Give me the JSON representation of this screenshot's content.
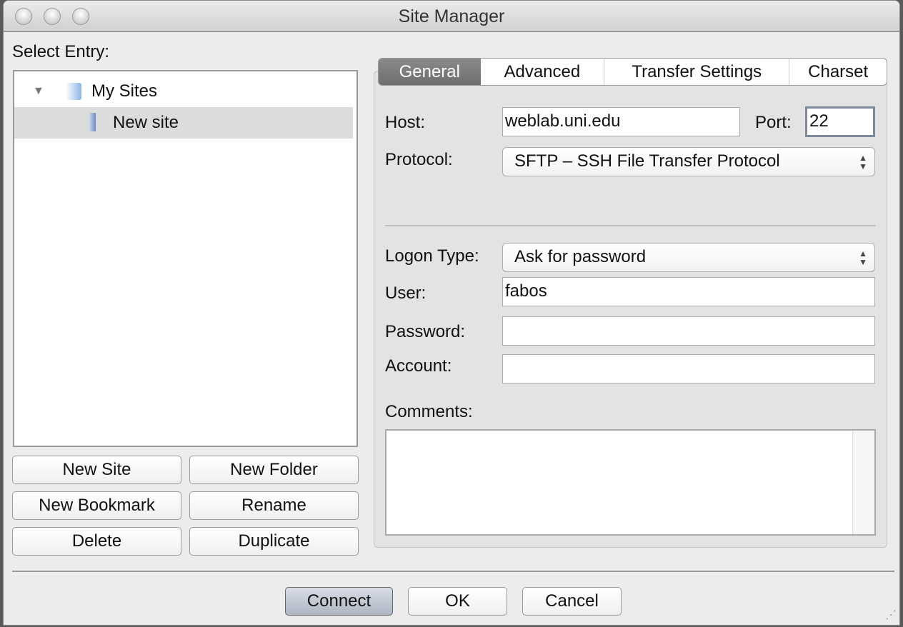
{
  "window": {
    "title": "Site Manager"
  },
  "left": {
    "select_entry_label": "Select Entry:",
    "tree": [
      {
        "label": "My Sites",
        "icon": "folder-icon",
        "expanded": true
      },
      {
        "label": "New site",
        "icon": "server-icon",
        "selected": true
      }
    ],
    "buttons": {
      "new_site": "New Site",
      "new_folder": "New Folder",
      "new_bookmark": "New Bookmark",
      "rename": "Rename",
      "delete": "Delete",
      "duplicate": "Duplicate"
    }
  },
  "tabs": [
    {
      "label": "General",
      "active": true
    },
    {
      "label": "Advanced"
    },
    {
      "label": "Transfer Settings"
    },
    {
      "label": "Charset"
    }
  ],
  "general": {
    "host_label": "Host:",
    "host_value": "weblab.uni.edu",
    "port_label": "Port:",
    "port_value": "22",
    "protocol_label": "Protocol:",
    "protocol_value": "SFTP – SSH File Transfer Protocol",
    "logon_type_label": "Logon Type:",
    "logon_type_value": "Ask for password",
    "user_label": "User:",
    "user_value": "fabos",
    "password_label": "Password:",
    "password_value": "",
    "account_label": "Account:",
    "account_value": "",
    "comments_label": "Comments:",
    "comments_value": ""
  },
  "footer": {
    "connect": "Connect",
    "ok": "OK",
    "cancel": "Cancel"
  }
}
